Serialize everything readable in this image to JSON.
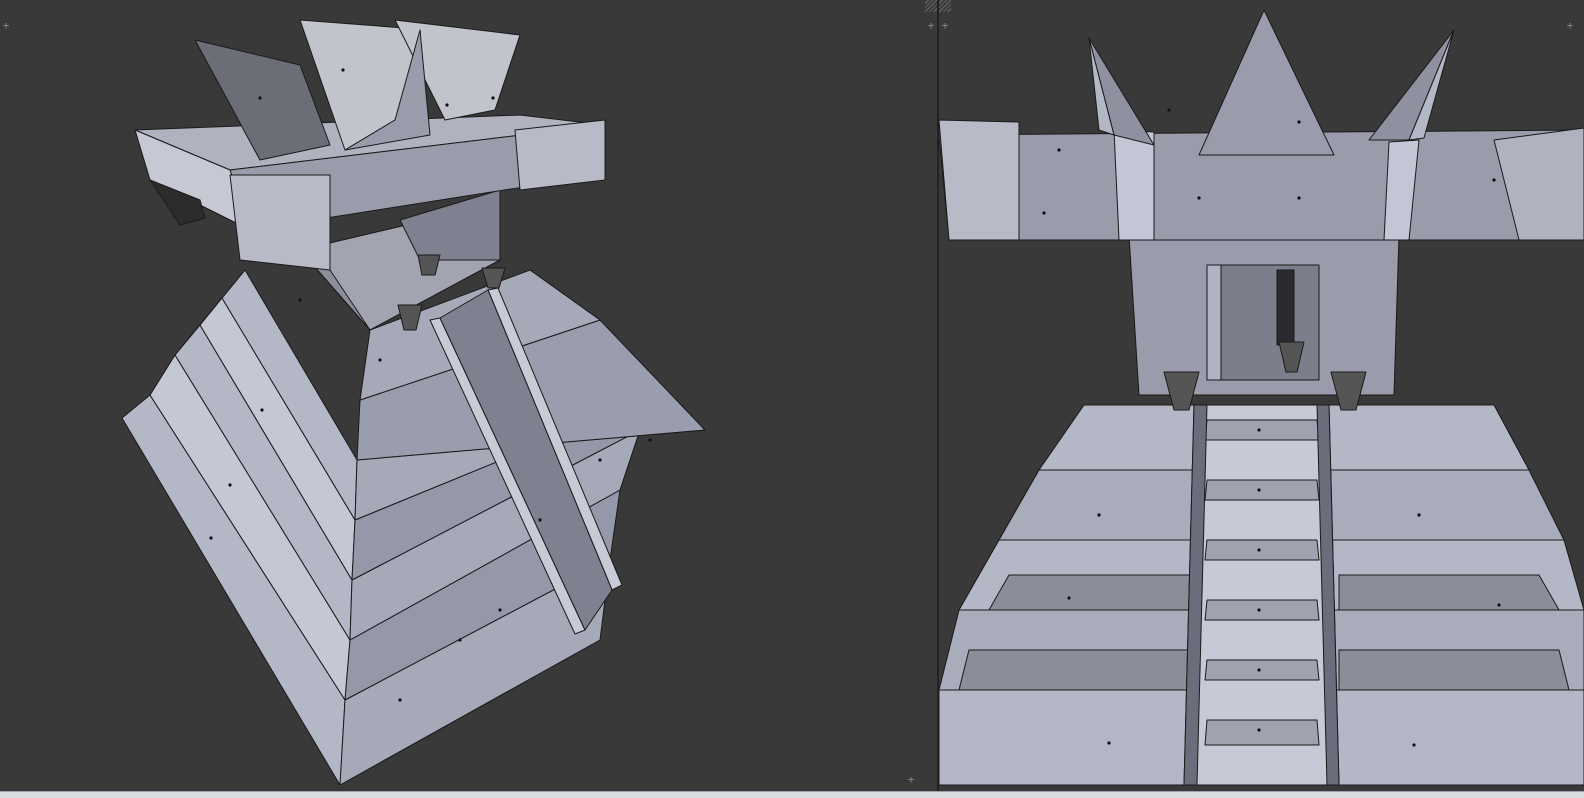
{
  "editor": {
    "left_viewport": {
      "view": "perspective",
      "widget_icon": "+"
    },
    "right_viewport": {
      "view": "perspective",
      "widget_icon": "+"
    }
  },
  "colors": {
    "background": "#393939",
    "mesh_light": "#b9bccb",
    "mesh_mid": "#9a9cab",
    "mesh_dark": "#6e707a",
    "edge": "#1a1a1a",
    "vertex": "#111111"
  },
  "icons": [
    "plus-icon",
    "hatch-corner-icon"
  ]
}
